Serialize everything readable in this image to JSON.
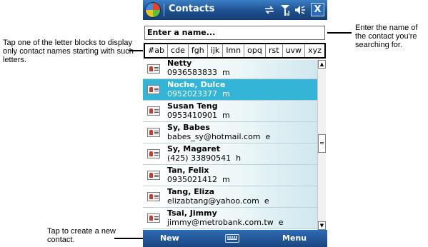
{
  "annotations": {
    "letter_blocks": "Tap one of the letter blocks to display only contact names starting with such letters.",
    "name_field": "Enter the name of the contact you're searching for.",
    "new_contact": "Tap to create a new contact."
  },
  "titlebar": {
    "title": "Contacts",
    "close_label": "X"
  },
  "search": {
    "placeholder": "Enter a name..."
  },
  "letter_filters": [
    "#ab",
    "cde",
    "fgh",
    "ijk",
    "lmn",
    "opq",
    "rst",
    "uvw",
    "xyz"
  ],
  "contacts": [
    {
      "name": "Netty",
      "detail": "0936583833",
      "type": "m"
    },
    {
      "name": "Noche, Dulce",
      "detail": "0952023377",
      "type": "m",
      "selected": true
    },
    {
      "name": "Susan Teng",
      "detail": "0953410901",
      "type": "m"
    },
    {
      "name": "Sy, Babes",
      "detail": "babes_sy@hotmail.com",
      "type": "e"
    },
    {
      "name": "Sy, Magaret",
      "detail": "(425) 33890541",
      "type": "h"
    },
    {
      "name": "Tan, Felix",
      "detail": "0935021412",
      "type": "m"
    },
    {
      "name": "Tang, Eliza",
      "detail": "elizabtang@yahoo.com",
      "type": "e"
    },
    {
      "name": "Tsai, Jimmy",
      "detail": "jimmy@metrobank.com.tw",
      "type": "e"
    }
  ],
  "menubar": {
    "left_softkey": "New",
    "right_softkey": "Menu"
  },
  "colors": {
    "selection": "#32b5d6",
    "titlebar": "#1e4f8e"
  }
}
